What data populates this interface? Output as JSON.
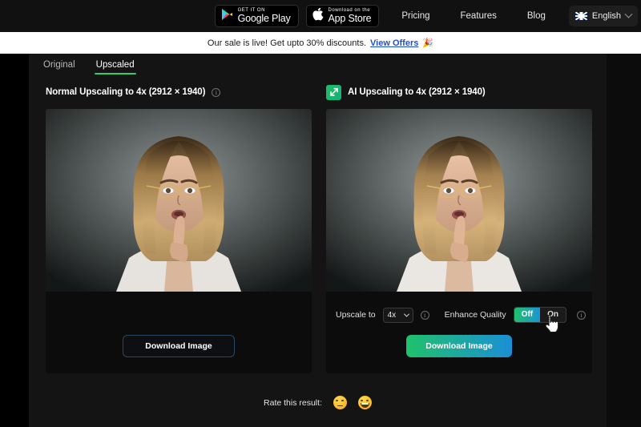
{
  "topnav": {
    "google_play": {
      "small": "GET IT ON",
      "large": "Google Play"
    },
    "app_store": {
      "small": "Download on the",
      "large": "App Store"
    },
    "links": [
      "Pricing",
      "Features",
      "Blog"
    ],
    "language": "English"
  },
  "banner": {
    "text": "Our sale is live! Get upto 30% discounts.",
    "cta": "View Offers",
    "emoji": "🎉"
  },
  "tabs": [
    {
      "label": "Original",
      "active": false
    },
    {
      "label": "Upscaled",
      "active": true
    }
  ],
  "panels": {
    "normal": {
      "title": "Normal Upscaling to 4x (2912 × 1940)",
      "download_label": "Download Image"
    },
    "ai": {
      "title": "AI Upscaling to 4x (2912 × 1940)",
      "download_label": "Download Image",
      "upscale_label": "Upscale to",
      "upscale_value": "4x",
      "enhance_label": "Enhance Quality",
      "toggle_off": "Off",
      "toggle_on": "On",
      "toggle_selected": "Off"
    }
  },
  "rate": {
    "label": "Rate this result:",
    "options": [
      "disappointed-face",
      "grinning-face"
    ]
  },
  "colors": {
    "accent_green": "#2fcf6a",
    "accent_blue": "#1b8fd6",
    "banner_link": "#1d4ed8",
    "page_bg": "#141414",
    "card_bg": "#0c0c0c"
  }
}
